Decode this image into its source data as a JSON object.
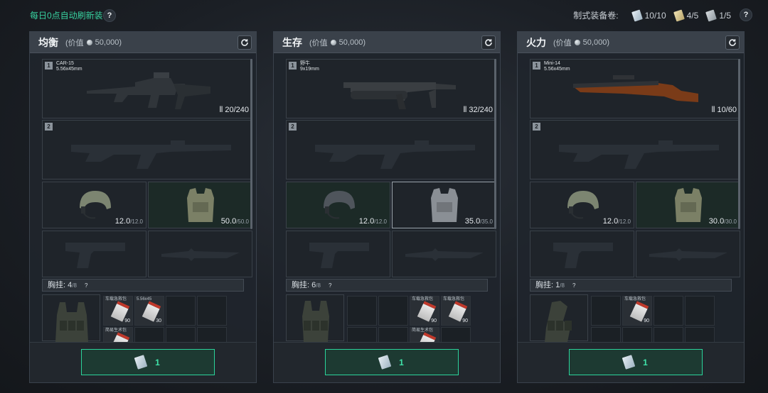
{
  "header": {
    "refresh_note": "每日0点自动刷新装备",
    "help_label": "?",
    "voucher_label": "制式装备卷:",
    "vouchers": [
      {
        "count": "10/10",
        "color": "#c9d8e2",
        "icon": "voucher-icon"
      },
      {
        "count": "4/5",
        "color": "#dccc8e",
        "icon": "voucher-icon"
      },
      {
        "count": "1/5",
        "color": "#b5bdc3",
        "icon": "voucher-icon"
      }
    ]
  },
  "panels": [
    {
      "title": "均衡",
      "value_label": "(价值",
      "value": "50,000)",
      "slot1": {
        "num": "1",
        "name": "CAR-15",
        "caliber": "5.56x45mm",
        "ammo": "20/240"
      },
      "slot2": {
        "num": "2"
      },
      "helmet": {
        "cur": "12.0",
        "max": "/12.0"
      },
      "armor": {
        "cur": "50.0",
        "max": "/50.0"
      },
      "rig": {
        "label": "胸挂:",
        "cur": "4",
        "max": "/8",
        "help": "?"
      },
      "items": [
        {
          "label": "车载急救包",
          "count": "90"
        },
        {
          "label": "5.56x45",
          "count": "30"
        },
        {
          "label": "简易生术包",
          "count": ""
        }
      ],
      "claim_count": "1"
    },
    {
      "title": "生存",
      "value_label": "(价值",
      "value": "50,000)",
      "slot1": {
        "num": "1",
        "name": "野牛",
        "caliber": "9x19mm",
        "ammo": "32/240"
      },
      "slot2": {
        "num": "2"
      },
      "helmet": {
        "cur": "12.0",
        "max": "/12.0"
      },
      "armor": {
        "cur": "35.0",
        "max": "/35.0"
      },
      "rig": {
        "label": "胸挂:",
        "cur": "6",
        "max": "/8",
        "help": "?"
      },
      "items": [
        {
          "label": "车载急救包",
          "count": "90"
        },
        {
          "label": "车载急救包",
          "count": "90"
        },
        {
          "label": "简易生术包",
          "count": ""
        }
      ],
      "claim_count": "1"
    },
    {
      "title": "火力",
      "value_label": "(价值",
      "value": "50,000)",
      "slot1": {
        "num": "1",
        "name": "Mini-14",
        "caliber": "5.56x45mm",
        "ammo": "10/60"
      },
      "slot2": {
        "num": "2"
      },
      "helmet": {
        "cur": "12.0",
        "max": "/12.0"
      },
      "armor": {
        "cur": "30.0",
        "max": "/30.0"
      },
      "rig": {
        "label": "胸挂:",
        "cur": "1",
        "max": "/8",
        "help": "?"
      },
      "items": [
        {
          "label": "车载急救包",
          "count": "90"
        }
      ],
      "claim_count": "1"
    }
  ]
}
